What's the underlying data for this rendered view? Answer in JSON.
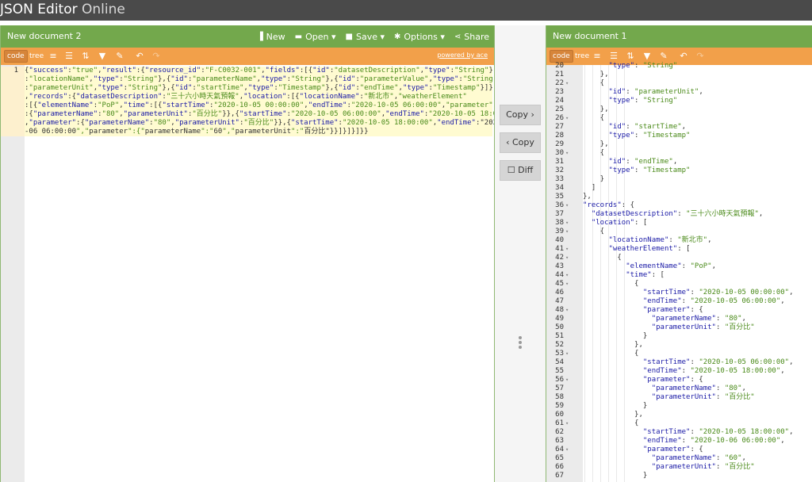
{
  "app": {
    "title_part1": "JSON Editor",
    "title_part2": "Online"
  },
  "left": {
    "doc_title": "New document 2",
    "menu": {
      "new": "New",
      "open": "Open ▾",
      "save": "Save ▾",
      "options": "Options ▾",
      "share": "Share"
    },
    "modes": {
      "code": "code",
      "tree": "tree"
    },
    "powered": "powered by ace",
    "line_number": "1",
    "code_lines": [
      "{\"success\":\"true\",\"result\":{\"resource_id\":\"F-C0032-001\",\"fields\":[{\"id\":\"datasetDescription\",\"type\":\"String\"},{\"id\"",
      ":\"locationName\",\"type\":\"String\"},{\"id\":\"parameterName\",\"type\":\"String\"},{\"id\":\"parameterValue\",\"type\":\"String\"},{\"id\"",
      ":\"parameterUnit\",\"type\":\"String\"},{\"id\":\"startTime\",\"type\":\"Timestamp\"},{\"id\":\"endTime\",\"type\":\"Timestamp\"}]}",
      ",\"records\":{\"datasetDescription\":\"三十六小時天氣預報\",\"location\":[{\"locationName\":\"新北市\",\"weatherElement\"",
      ":[{\"elementName\":\"PoP\",\"time\":[{\"startTime\":\"2020-10-05 00:00:00\",\"endTime\":\"2020-10-05 06:00:00\",\"parameter\"",
      ":{\"parameterName\":\"80\",\"parameterUnit\":\"百分比\"}},{\"startTime\":\"2020-10-05 06:00:00\",\"endTime\":\"2020-10-05 18:00:00\"",
      ",\"parameter\":{\"parameterName\":\"80\",\"parameterUnit\":\"百分比\"}},{\"startTime\":\"2020-10-05 18:00:00\",\"endTime\":\"2020-10",
      "-06 06:00:00\",\"parameter\":{\"parameterName\":\"60\",\"parameterUnit\":\"百分比\"}}]}]}]}}"
    ]
  },
  "splitter": {
    "copy_right": "Copy ›",
    "copy_left": "‹ Copy",
    "diff": "☐ Diff"
  },
  "right": {
    "doc_title": "New document 1",
    "modes": {
      "code": "code",
      "tree": "tree"
    },
    "lines": [
      {
        "n": "20",
        "f": "",
        "c": "      \"type\": \"String\""
      },
      {
        "n": "21",
        "f": "",
        "c": "    },"
      },
      {
        "n": "22",
        "f": "▾",
        "c": "    {"
      },
      {
        "n": "23",
        "f": "",
        "c": "      \"id\": \"parameterUnit\","
      },
      {
        "n": "24",
        "f": "",
        "c": "      \"type\": \"String\""
      },
      {
        "n": "25",
        "f": "",
        "c": "    },"
      },
      {
        "n": "26",
        "f": "▾",
        "c": "    {"
      },
      {
        "n": "27",
        "f": "",
        "c": "      \"id\": \"startTime\","
      },
      {
        "n": "28",
        "f": "",
        "c": "      \"type\": \"Timestamp\""
      },
      {
        "n": "29",
        "f": "",
        "c": "    },"
      },
      {
        "n": "30",
        "f": "▾",
        "c": "    {"
      },
      {
        "n": "31",
        "f": "",
        "c": "      \"id\": \"endTime\","
      },
      {
        "n": "32",
        "f": "",
        "c": "      \"type\": \"Timestamp\""
      },
      {
        "n": "33",
        "f": "",
        "c": "    }"
      },
      {
        "n": "34",
        "f": "",
        "c": "  ]"
      },
      {
        "n": "35",
        "f": "",
        "c": "},"
      },
      {
        "n": "36",
        "f": "▾",
        "c": "\"records\": {"
      },
      {
        "n": "37",
        "f": "",
        "c": "  \"datasetDescription\": \"三十六小時天氣預報\","
      },
      {
        "n": "38",
        "f": "▾",
        "c": "  \"location\": ["
      },
      {
        "n": "39",
        "f": "▾",
        "c": "    {"
      },
      {
        "n": "40",
        "f": "",
        "c": "      \"locationName\": \"新北市\","
      },
      {
        "n": "41",
        "f": "▾",
        "c": "      \"weatherElement\": ["
      },
      {
        "n": "42",
        "f": "▾",
        "c": "        {"
      },
      {
        "n": "43",
        "f": "",
        "c": "          \"elementName\": \"PoP\","
      },
      {
        "n": "44",
        "f": "▾",
        "c": "          \"time\": ["
      },
      {
        "n": "45",
        "f": "▾",
        "c": "            {"
      },
      {
        "n": "46",
        "f": "",
        "c": "              \"startTime\": \"2020-10-05 00:00:00\","
      },
      {
        "n": "47",
        "f": "",
        "c": "              \"endTime\": \"2020-10-05 06:00:00\","
      },
      {
        "n": "48",
        "f": "▾",
        "c": "              \"parameter\": {"
      },
      {
        "n": "49",
        "f": "",
        "c": "                \"parameterName\": \"80\","
      },
      {
        "n": "50",
        "f": "",
        "c": "                \"parameterUnit\": \"百分比\""
      },
      {
        "n": "51",
        "f": "",
        "c": "              }"
      },
      {
        "n": "52",
        "f": "",
        "c": "            },"
      },
      {
        "n": "53",
        "f": "▾",
        "c": "            {"
      },
      {
        "n": "54",
        "f": "",
        "c": "              \"startTime\": \"2020-10-05 06:00:00\","
      },
      {
        "n": "55",
        "f": "",
        "c": "              \"endTime\": \"2020-10-05 18:00:00\","
      },
      {
        "n": "56",
        "f": "▾",
        "c": "              \"parameter\": {"
      },
      {
        "n": "57",
        "f": "",
        "c": "                \"parameterName\": \"80\","
      },
      {
        "n": "58",
        "f": "",
        "c": "                \"parameterUnit\": \"百分比\""
      },
      {
        "n": "59",
        "f": "",
        "c": "              }"
      },
      {
        "n": "60",
        "f": "",
        "c": "            },"
      },
      {
        "n": "61",
        "f": "▾",
        "c": "            {"
      },
      {
        "n": "62",
        "f": "",
        "c": "              \"startTime\": \"2020-10-05 18:00:00\","
      },
      {
        "n": "63",
        "f": "",
        "c": "              \"endTime\": \"2020-10-06 06:00:00\","
      },
      {
        "n": "64",
        "f": "▾",
        "c": "              \"parameter\": {"
      },
      {
        "n": "65",
        "f": "",
        "c": "                \"parameterName\": \"60\","
      },
      {
        "n": "66",
        "f": "",
        "c": "                \"parameterUnit\": \"百分比\""
      },
      {
        "n": "67",
        "f": "",
        "c": "              }"
      }
    ]
  },
  "colors": {
    "header": "#4a4a4a",
    "menu_green": "#73a84c",
    "menu_orange": "#f2a04a",
    "string": "#4a8a19",
    "key": "#1a1aa6"
  },
  "icons": [
    "file-icon",
    "folder-icon",
    "save-icon",
    "gear-icon",
    "share-icon",
    "format-icon",
    "compact-icon",
    "sort-icon",
    "filter-icon",
    "repair-icon",
    "undo-icon",
    "redo-icon"
  ]
}
